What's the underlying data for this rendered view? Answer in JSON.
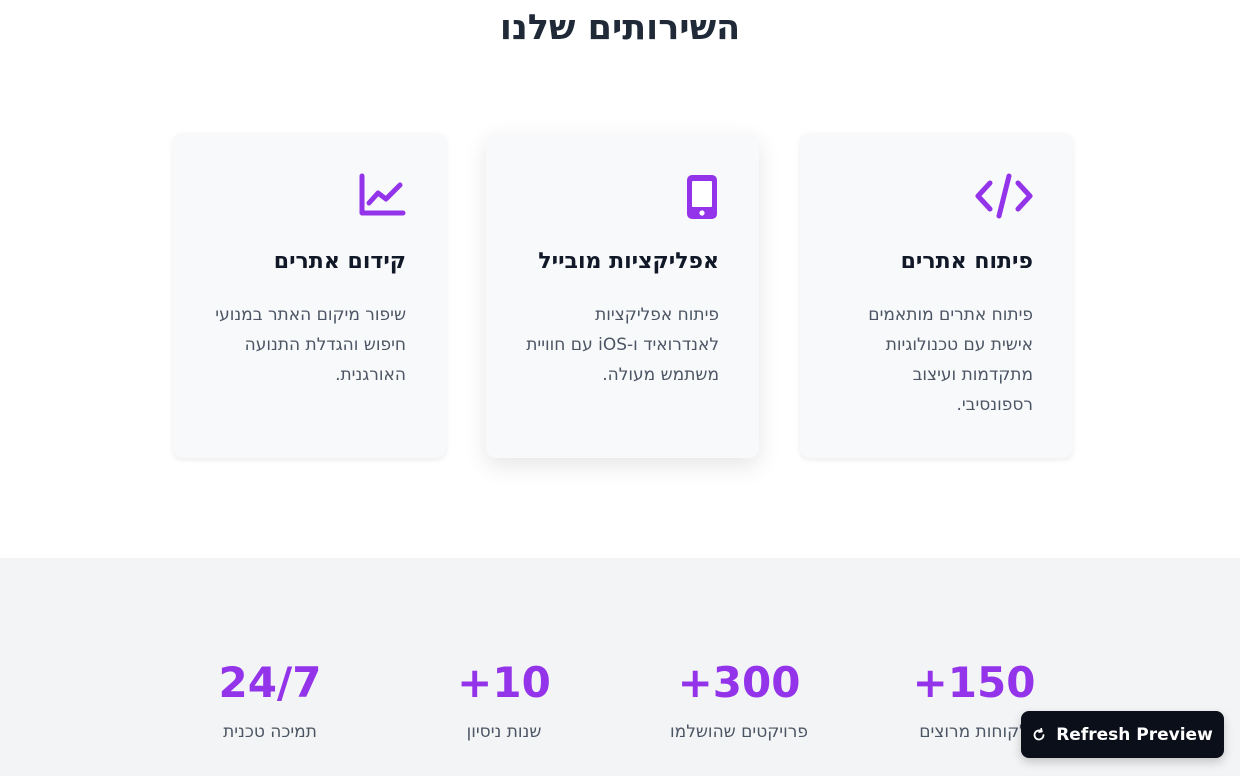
{
  "services": {
    "title": "השירותים שלנו",
    "cards": [
      {
        "icon": "code-icon",
        "title": "פיתוח אתרים",
        "description": "פיתוח אתרים מותאמים אישית עם טכנולוגיות מתקדמות ועיצוב רספונסיבי."
      },
      {
        "icon": "mobile-phone-icon",
        "title": "אפליקציות מובייל",
        "description": "פיתוח אפליקציות לאנדרואיד ו-iOS עם חוויית משתמש מעולה."
      },
      {
        "icon": "chart-line-icon",
        "title": "קידום אתרים",
        "description": "שיפור מיקום האתר במנועי חיפוש והגדלת התנועה האורגנית."
      }
    ]
  },
  "stats": [
    {
      "value": "+150",
      "label": "לקוחות מרוצים"
    },
    {
      "value": "+300",
      "label": "פרויקטים שהושלמו"
    },
    {
      "value": "+10",
      "label": "שנות ניסיון"
    },
    {
      "value": "24/7",
      "label": "תמיכה טכנית"
    }
  ],
  "refresh_button": {
    "label": "Refresh Preview",
    "icon": "refresh-icon"
  },
  "colors": {
    "accent": "#9333ea",
    "title": "#1f2937",
    "text_muted": "#4b5563",
    "card_bg": "#f8f9fb",
    "stats_bg": "#f3f4f6",
    "button_bg": "#0b0f19"
  }
}
